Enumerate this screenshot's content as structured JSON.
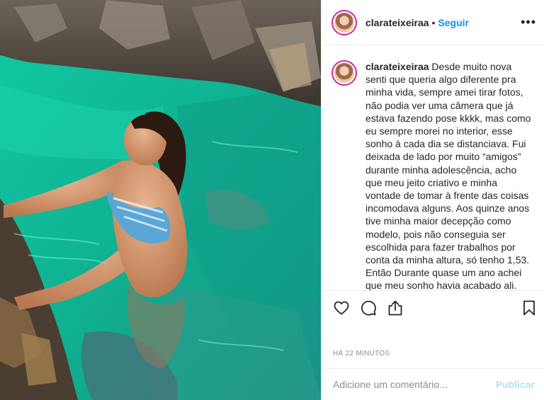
{
  "post": {
    "image_alt": "Mulher em piscina natural de água verde-esmeralda entre rochas"
  },
  "header": {
    "username": "clarateixeiraa",
    "separator": "•",
    "follow_label": "Seguir",
    "more_icon": "more-horizontal-icon",
    "more_glyph": "•••"
  },
  "caption": {
    "username": "clarateixeiraa",
    "text": " Desde muito nova senti que queria algo diferente pra minha vida, sempre amei tirar fotos, não podia ver uma câmera que já estava fazendo pose kkkk, mas como eu sempre morei no interior, esse sonho à cada dia se distanciava. Fui deixada de lado por muito “amigos” durante minha adolescência, acho que meu jeito criativo e minha vontade de tomar à frente das coisas incomodava alguns. Aos quinze anos tive minha maior decepção como modelo, pois não conseguia ser escolhida para fazer trabalhos por conta da minha altura, só tenho 1,53.\nEntão Durante quase um ano achei que meu sonho havia acabado ali.\nLogo comecei minha jornada na"
  },
  "actions": {
    "like_icon": "heart-icon",
    "comment_icon": "comment-icon",
    "share_icon": "share-icon",
    "save_icon": "bookmark-icon"
  },
  "timestamp": "HÁ 22 MINUTOS",
  "comment_box": {
    "placeholder": "Adicione um comentário...",
    "publish_label": "Publicar"
  },
  "colors": {
    "link": "#0095f6",
    "publish_disabled": "#b2dffc",
    "muted": "#8e8e8e",
    "border": "#efefef"
  }
}
